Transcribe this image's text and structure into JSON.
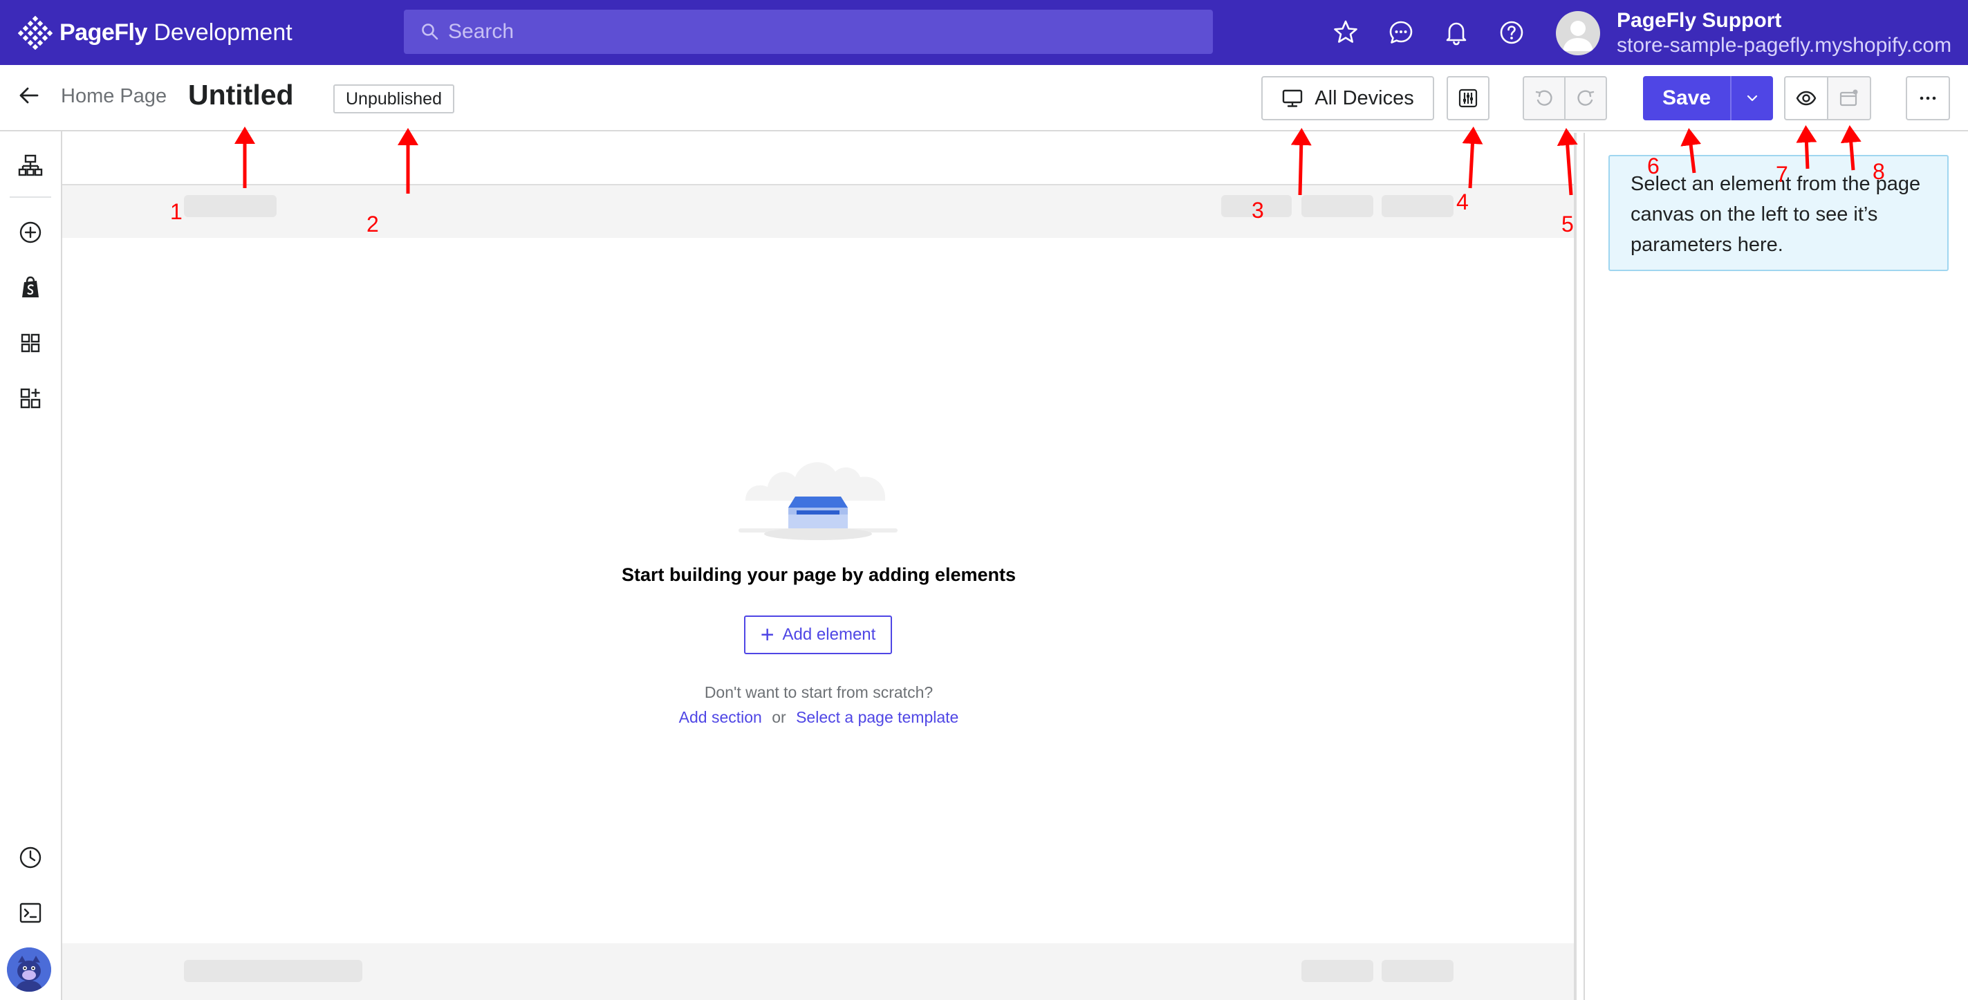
{
  "topbar": {
    "brand_name": "PageFly",
    "brand_suffix": "Development",
    "search_placeholder": "Search",
    "icons": [
      "star-icon",
      "chat-icon",
      "bell-icon",
      "help-icon"
    ],
    "user_name": "PageFly Support",
    "user_store": "store-sample-pagefly.myshopify.com"
  },
  "toolbar": {
    "breadcrumb": "Home Page",
    "page_title": "Untitled",
    "status": "Unpublished",
    "devices_label": "All Devices",
    "save_label": "Save"
  },
  "sidebar": {
    "items": [
      "layers-icon",
      "add-element-icon",
      "shopify-icon",
      "grid-icon",
      "add-block-icon"
    ],
    "bottom": [
      "history-icon",
      "terminal-icon",
      "mascot-avatar"
    ]
  },
  "canvas": {
    "empty_title": "Start building your page by adding elements",
    "add_button": "Add element",
    "scratch_question": "Don't want to start from scratch?",
    "add_section_link": "Add section",
    "or_text": "or",
    "template_link": "Select a page template"
  },
  "right_panel": {
    "hint": "Select an element from the page canvas on the left to see it’s parameters here."
  },
  "annotations": [
    "1",
    "2",
    "3",
    "4",
    "5",
    "6",
    "7",
    "8"
  ],
  "colors": {
    "topbar": "#3c2ab9",
    "accent": "#4f46e5",
    "annotation": "#ff0000",
    "hint_bg": "#e7f6fd"
  }
}
